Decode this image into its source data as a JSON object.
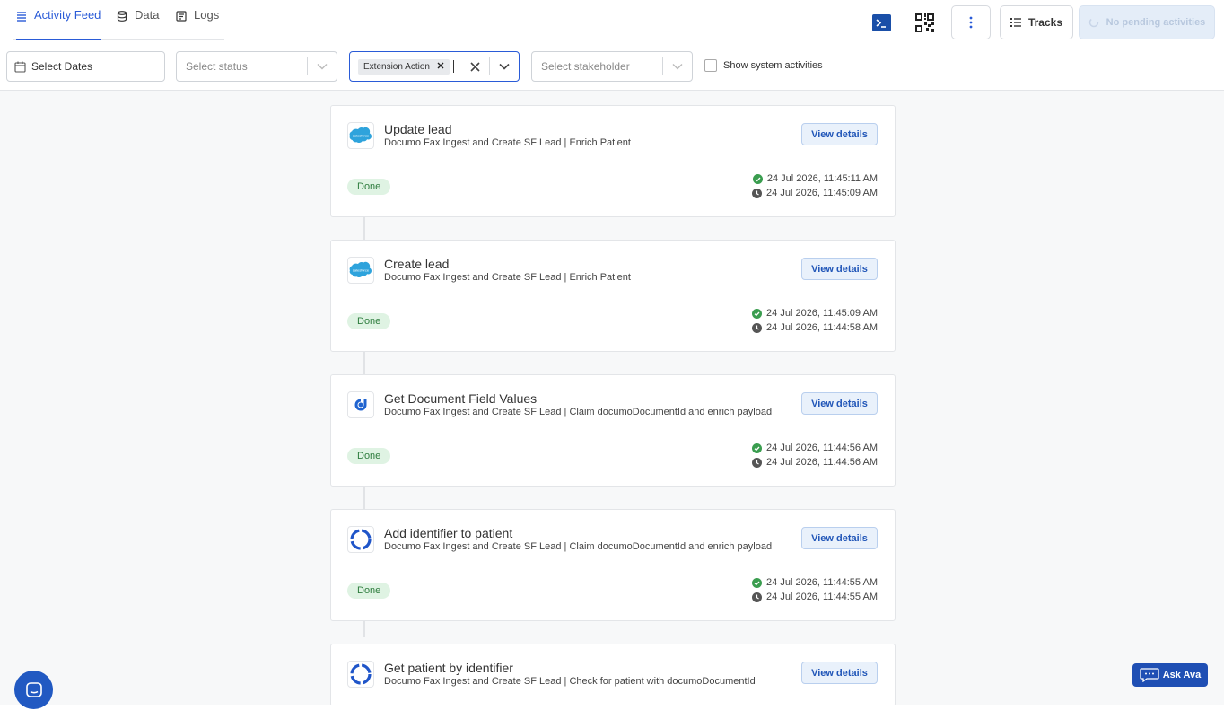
{
  "tabs": [
    {
      "label": "Activity Feed",
      "icon": "list-icon",
      "active": true
    },
    {
      "label": "Data",
      "icon": "database-icon",
      "active": false
    },
    {
      "label": "Logs",
      "icon": "logs-icon",
      "active": false
    }
  ],
  "toolbar": {
    "tracks_label": "Tracks",
    "pending_label": "No pending activities"
  },
  "filters": {
    "dates_label": "Select Dates",
    "status_placeholder": "Select status",
    "action_chip": "Extension Action",
    "stakeholder_placeholder": "Select stakeholder",
    "system_label": "Show system activities"
  },
  "cards": [
    {
      "title": "Update lead",
      "subtitle": "Documo Fax Ingest and Create SF Lead | Enrich Patient",
      "status": "Done",
      "completed": "24 Jul 2026, 11:45:11 AM",
      "started": "24 Jul 2026, 11:45:09 AM",
      "logo": "salesforce-logo",
      "button": "View details"
    },
    {
      "title": "Create lead",
      "subtitle": "Documo Fax Ingest and Create SF Lead | Enrich Patient",
      "status": "Done",
      "completed": "24 Jul 2026, 11:45:09 AM",
      "started": "24 Jul 2026, 11:44:58 AM",
      "logo": "salesforce-logo",
      "button": "View details"
    },
    {
      "title": "Get Document Field Values",
      "subtitle": "Documo Fax Ingest and Create SF Lead | Claim documoDocumentId and enrich payload",
      "status": "Done",
      "completed": "24 Jul 2026, 11:44:56 AM",
      "started": "24 Jul 2026, 11:44:56 AM",
      "logo": "documo-logo",
      "button": "View details"
    },
    {
      "title": "Add identifier to patient",
      "subtitle": "Documo Fax Ingest and Create SF Lead | Claim documoDocumentId and enrich payload",
      "status": "Done",
      "completed": "24 Jul 2026, 11:44:55 AM",
      "started": "24 Jul 2026, 11:44:55 AM",
      "logo": "awell-logo",
      "button": "View details"
    },
    {
      "title": "Get patient by identifier",
      "subtitle": "Documo Fax Ingest and Create SF Lead | Check for patient with documoDocumentId",
      "status": "",
      "completed": "",
      "started": "",
      "logo": "awell-logo",
      "button": "View details"
    }
  ],
  "ask_ava": "Ask Ava",
  "colors": {
    "accent": "#2a5bd7",
    "done_bg": "#dff3e3",
    "done_text": "#2f7d3f"
  }
}
